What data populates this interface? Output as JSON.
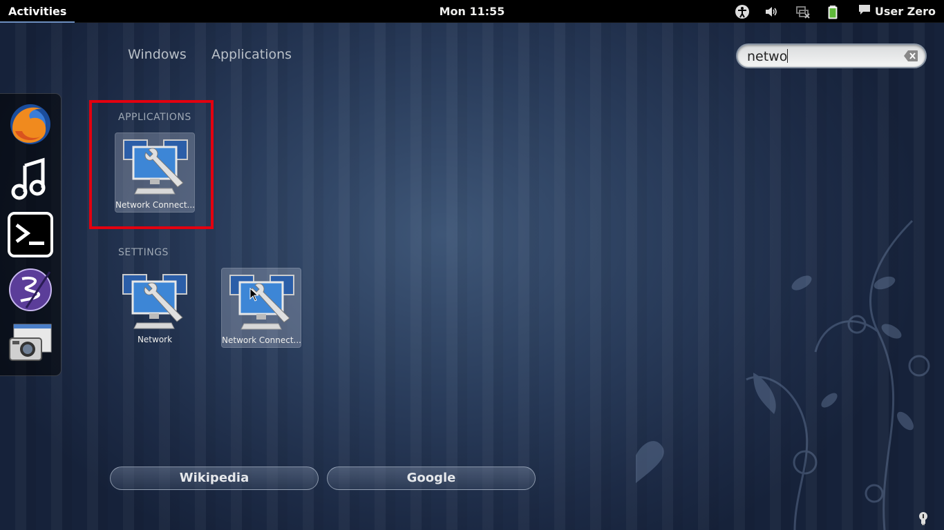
{
  "top_panel": {
    "activities_label": "Activities",
    "clock": "Mon 11:55",
    "user_name": "User Zero",
    "status_icons": [
      "accessibility-icon",
      "volume-icon",
      "network-icon",
      "battery-icon",
      "chat-icon"
    ]
  },
  "view_selector": {
    "windows_label": "Windows",
    "applications_label": "Applications"
  },
  "search": {
    "value": "netwo"
  },
  "dash": {
    "items": [
      "firefox-icon",
      "rhythmbox-icon",
      "terminal-icon",
      "emacs-icon",
      "screenshot-icon"
    ]
  },
  "results": {
    "applications_title": "APPLICATIONS",
    "settings_title": "SETTINGS",
    "applications": [
      {
        "label": "Network Connect..."
      }
    ],
    "settings": [
      {
        "label": "Network"
      },
      {
        "label": "Network Connect..."
      }
    ]
  },
  "search_providers": {
    "wikipedia_label": "Wikipedia",
    "google_label": "Google"
  },
  "colors": {
    "highlight": "#e3000f",
    "panel": "#000000",
    "background": "#2a3d5c"
  }
}
